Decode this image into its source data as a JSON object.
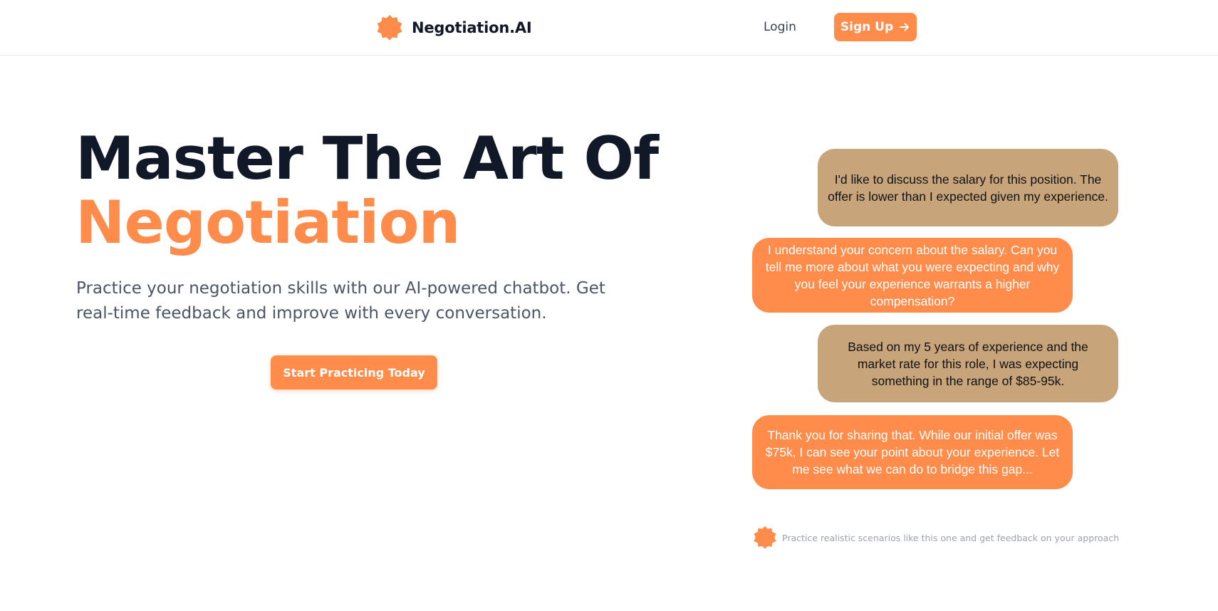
{
  "header": {
    "brand_name": "Negotiation.AI",
    "logo_icon": "starburst-logo-icon",
    "login_label": "Login",
    "signup_label": "Sign Up",
    "signup_icon": "arrow-right-icon"
  },
  "hero": {
    "title_line1": "Master The Art Of",
    "title_line2": "Negotiation",
    "subtitle": "Practice your negotiation skills with our AI-powered chatbot. Get real-time feedback and improve with every conversation.",
    "cta_label": "Start Practicing Today"
  },
  "chat": {
    "messages": [
      {
        "role": "user",
        "text": "I'd like to discuss the salary for this position. The offer is lower than I expected given my experience."
      },
      {
        "role": "ai",
        "text": "I understand your concern about the salary. Can you tell me more about what you were expecting and why you feel your experience warrants a higher compensation?"
      },
      {
        "role": "user",
        "text": "Based on my 5 years of experience and the market rate for this role, I was expecting something in the range of $85-95k."
      },
      {
        "role": "ai",
        "text": "Thank you for sharing that. While our initial offer was $75k, I can see your point about your experience. Let me see what we can do to bridge this gap..."
      }
    ],
    "footnote": "Practice realistic scenarios like this one and get feedback on your approach"
  },
  "colors": {
    "accent": "#ff8c4b",
    "user_bubble": "#c8a47b",
    "heading": "#111827",
    "body_text": "#4b5563",
    "muted_text": "#9ca3af"
  }
}
